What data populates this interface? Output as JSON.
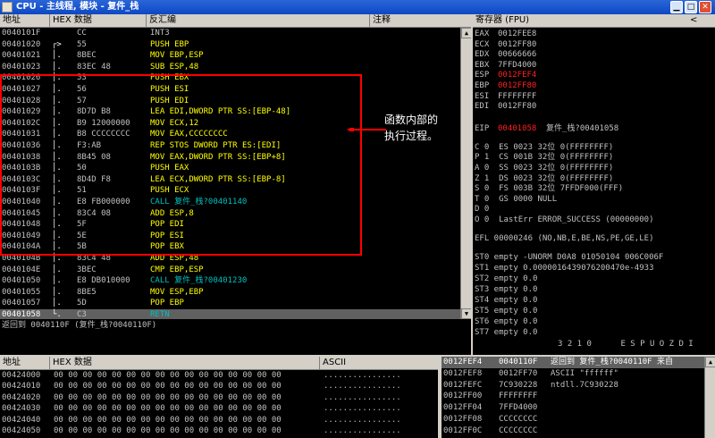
{
  "window": {
    "title": "CPU - 主线程, 模块 - 复件_栈"
  },
  "disasm": {
    "headers": {
      "addr": "地址",
      "hex": "HEX 数据",
      "asm": "反汇编",
      "comment": "注释"
    },
    "rows": [
      {
        "addr": "0040101F",
        "sym": "",
        "hex": "CC",
        "asm": "INT3",
        "asmColor": "gray"
      },
      {
        "addr": "00401020",
        "sym": "┌>",
        "hex": "55",
        "asm": "PUSH EBP",
        "asmColor": "yel"
      },
      {
        "addr": "00401021",
        "sym": "│.",
        "hex": "8BEC",
        "asm": "MOV EBP,ESP",
        "asmColor": "yel"
      },
      {
        "addr": "00401023",
        "sym": "│.",
        "hex": "83EC 48",
        "asm": "SUB ESP,48",
        "asmColor": "yel"
      },
      {
        "addr": "00401026",
        "sym": "│.",
        "hex": "53",
        "asm": "PUSH EBX",
        "asmColor": "yel"
      },
      {
        "addr": "00401027",
        "sym": "│.",
        "hex": "56",
        "asm": "PUSH ESI",
        "asmColor": "yel"
      },
      {
        "addr": "00401028",
        "sym": "│.",
        "hex": "57",
        "asm": "PUSH EDI",
        "asmColor": "yel"
      },
      {
        "addr": "00401029",
        "sym": "│.",
        "hex": "8D7D B8",
        "asm": "LEA EDI,DWORD PTR SS:[EBP-48]",
        "asmColor": "yel"
      },
      {
        "addr": "0040102C",
        "sym": "│.",
        "hex": "B9 12000000",
        "asm": "MOV ECX,12",
        "asmColor": "yel"
      },
      {
        "addr": "00401031",
        "sym": "│.",
        "hex": "B8 CCCCCCCC",
        "asm": "MOV EAX,CCCCCCCC",
        "asmColor": "yel"
      },
      {
        "addr": "00401036",
        "sym": "│.",
        "hex": "F3:AB",
        "asm": "REP STOS DWORD PTR ES:[EDI]",
        "asmColor": "yel"
      },
      {
        "addr": "00401038",
        "sym": "│.",
        "hex": "8B45 08",
        "asm": "MOV EAX,DWORD PTR SS:[EBP+8]",
        "asmColor": "yel"
      },
      {
        "addr": "0040103B",
        "sym": "│.",
        "hex": "50",
        "asm": "PUSH EAX",
        "asmColor": "yel"
      },
      {
        "addr": "0040103C",
        "sym": "│.",
        "hex": "8D4D F8",
        "asm": "LEA ECX,DWORD PTR SS:[EBP-8]",
        "asmColor": "yel"
      },
      {
        "addr": "0040103F",
        "sym": "│.",
        "hex": "51",
        "asm": "PUSH ECX",
        "asmColor": "yel"
      },
      {
        "addr": "00401040",
        "sym": "│.",
        "hex": "E8 FB000000",
        "asm": "CALL 复件_栈?00401140",
        "asmColor": "cyan"
      },
      {
        "addr": "00401045",
        "sym": "│.",
        "hex": "83C4 08",
        "asm": "ADD ESP,8",
        "asmColor": "yel"
      },
      {
        "addr": "00401048",
        "sym": "│.",
        "hex": "5F",
        "asm": "POP EDI",
        "asmColor": "yel"
      },
      {
        "addr": "00401049",
        "sym": "│.",
        "hex": "5E",
        "asm": "POP ESI",
        "asmColor": "yel"
      },
      {
        "addr": "0040104A",
        "sym": "│.",
        "hex": "5B",
        "asm": "POP EBX",
        "asmColor": "yel"
      },
      {
        "addr": "0040104B",
        "sym": "│.",
        "hex": "83C4 48",
        "asm": "ADD ESP,48",
        "asmColor": "yel"
      },
      {
        "addr": "0040104E",
        "sym": "│.",
        "hex": "3BEC",
        "asm": "CMP EBP,ESP",
        "asmColor": "yel"
      },
      {
        "addr": "00401050",
        "sym": "│.",
        "hex": "E8 DB010000",
        "asm": "CALL 复件_栈?00401230",
        "asmColor": "cyan"
      },
      {
        "addr": "00401055",
        "sym": "│.",
        "hex": "8BE5",
        "asm": "MOV ESP,EBP",
        "asmColor": "yel"
      },
      {
        "addr": "00401057",
        "sym": "│.",
        "hex": "5D",
        "asm": "POP EBP",
        "asmColor": "yel"
      },
      {
        "addr": "00401058",
        "sym": "└.",
        "hex": "C3",
        "asm": "RETN",
        "asmColor": "cyan",
        "selected": true
      }
    ]
  },
  "annotation": {
    "text": "函数内部的\n执行过程。"
  },
  "status": {
    "line": "返回到 0040110F (复件_栈?0040110F)"
  },
  "registers": {
    "header": "寄存器 (FPU)",
    "header_arrow": "<",
    "general": [
      {
        "name": "EAX",
        "value": "0012FEE8",
        "changed": false
      },
      {
        "name": "ECX",
        "value": "0012FF80",
        "changed": false
      },
      {
        "name": "EDX",
        "value": "00666666",
        "changed": false
      },
      {
        "name": "EBX",
        "value": "7FFD4000",
        "changed": false
      },
      {
        "name": "ESP",
        "value": "0012FEF4",
        "changed": true
      },
      {
        "name": "EBP",
        "value": "0012FF80",
        "changed": true
      },
      {
        "name": "ESI",
        "value": "FFFFFFFF",
        "changed": false
      },
      {
        "name": "EDI",
        "value": "0012FF80",
        "changed": false
      }
    ],
    "eip": {
      "name": "EIP",
      "value": "00401058",
      "note": "复件_栈?00401058"
    },
    "flags": [
      "C 0  ES 0023 32位 0(FFFFFFFF)",
      "P 1  CS 001B 32位 0(FFFFFFFF)",
      "A 0  SS 0023 32位 0(FFFFFFFF)",
      "Z 1  DS 0023 32位 0(FFFFFFFF)",
      "S 0  FS 003B 32位 7FFDF000(FFF)",
      "T 0  GS 0000 NULL",
      "D 0",
      "O 0  LastErr ERROR_SUCCESS (00000000)"
    ],
    "efl": "EFL 00000246 (NO,NB,E,BE,NS,PE,GE,LE)",
    "fpu": [
      "ST0 empty -UNORM D0A8 01050104 006C006F",
      "ST1 empty 0.0000016439076200470e-4933",
      "ST2 empty 0.0",
      "ST3 empty 0.0",
      "ST4 empty 0.0",
      "ST5 empty 0.0",
      "ST6 empty 0.0",
      "ST7 empty 0.0"
    ],
    "fpu_footer": "3 2 1 0      E S P U O Z D I"
  },
  "dump": {
    "headers": {
      "addr": "地址",
      "hex": "HEX 数据",
      "ascii": "ASCII"
    },
    "rows": [
      {
        "addr": "00424000",
        "hex": "00 00 00 00 00 00 00 00 00 00 00 00 00 00 00 00",
        "ascii": "................"
      },
      {
        "addr": "00424010",
        "hex": "00 00 00 00 00 00 00 00 00 00 00 00 00 00 00 00",
        "ascii": "................"
      },
      {
        "addr": "00424020",
        "hex": "00 00 00 00 00 00 00 00 00 00 00 00 00 00 00 00",
        "ascii": "................"
      },
      {
        "addr": "00424030",
        "hex": "00 00 00 00 00 00 00 00 00 00 00 00 00 00 00 00",
        "ascii": "................"
      },
      {
        "addr": "00424040",
        "hex": "00 00 00 00 00 00 00 00 00 00 00 00 00 00 00 00",
        "ascii": "................"
      },
      {
        "addr": "00424050",
        "hex": "00 00 00 00 00 00 00 00 00 00 00 00 00 00 00 00",
        "ascii": "................"
      }
    ]
  },
  "stack": {
    "rows": [
      {
        "addr": "0012FEF4",
        "value": "0040110F",
        "comment": "返回到 复件_栈?0040110F 来自",
        "selected": true
      },
      {
        "addr": "0012FEF8",
        "value": "0012FF70",
        "comment": "ASCII \"ffffff\""
      },
      {
        "addr": "0012FEFC",
        "value": "7C930228",
        "comment": "ntdll.7C930228"
      },
      {
        "addr": "0012FF00",
        "value": "FFFFFFFF",
        "comment": ""
      },
      {
        "addr": "0012FF04",
        "value": "7FFD4000",
        "comment": ""
      },
      {
        "addr": "0012FF08",
        "value": "CCCCCCCC",
        "comment": ""
      },
      {
        "addr": "0012FF0C",
        "value": "CCCCCCCC",
        "comment": ""
      }
    ]
  },
  "colors": {
    "accent": "#ff0000",
    "selection": "#606060",
    "highlight": "#ff2020"
  }
}
